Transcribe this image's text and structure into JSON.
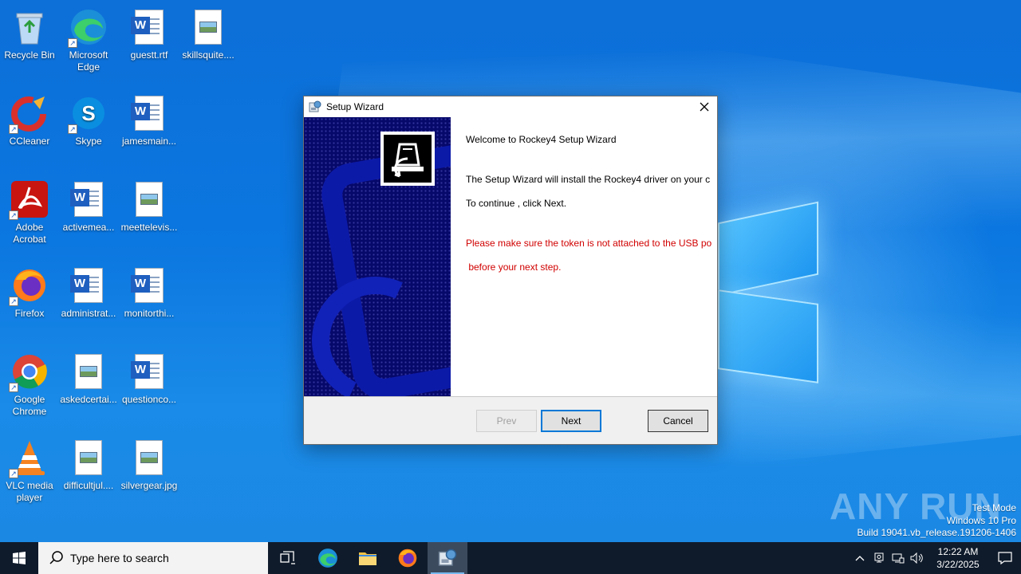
{
  "desktop": {
    "icons": [
      {
        "label": "Recycle Bin"
      },
      {
        "label": "Microsoft Edge"
      },
      {
        "label": "guestt.rtf"
      },
      {
        "label": "skillsquite...."
      },
      {
        "label": "CCleaner"
      },
      {
        "label": "Skype"
      },
      {
        "label": "jamesmain..."
      },
      {
        "label": "Adobe Acrobat"
      },
      {
        "label": "activemea..."
      },
      {
        "label": "meettelevis..."
      },
      {
        "label": "Firefox"
      },
      {
        "label": "administrat..."
      },
      {
        "label": "monitorthi..."
      },
      {
        "label": "Google Chrome"
      },
      {
        "label": "askedcertai..."
      },
      {
        "label": "questionco..."
      },
      {
        "label": "VLC media player"
      },
      {
        "label": "difficultjul...."
      },
      {
        "label": "silvergear.jpg"
      }
    ]
  },
  "wizard": {
    "title": "Setup Wizard",
    "welcome": "Welcome to Rockey4 Setup Wizard",
    "install_text": "The Setup Wizard will install the Rockey4 driver on your c",
    "continue_text": "To continue , click Next.",
    "warning_line1": "Please make sure the token is not attached to the USB po",
    "warning_line2": " before your next step.",
    "buttons": {
      "prev": "Prev",
      "next": "Next",
      "cancel": "Cancel"
    }
  },
  "watermark": "ANY RUN",
  "system_info": {
    "mode": "Test Mode",
    "os": "Windows 10 Pro",
    "build": "Build 19041.vb_release.191206-1406"
  },
  "taskbar": {
    "search_placeholder": "Type here to search",
    "clock_time": "12:22 AM",
    "clock_date": "3/22/2025"
  },
  "colors": {
    "taskbar": "#0f1b2b",
    "warning_text": "#d10000",
    "banner": "#06086a",
    "accent": "#0078d7"
  }
}
